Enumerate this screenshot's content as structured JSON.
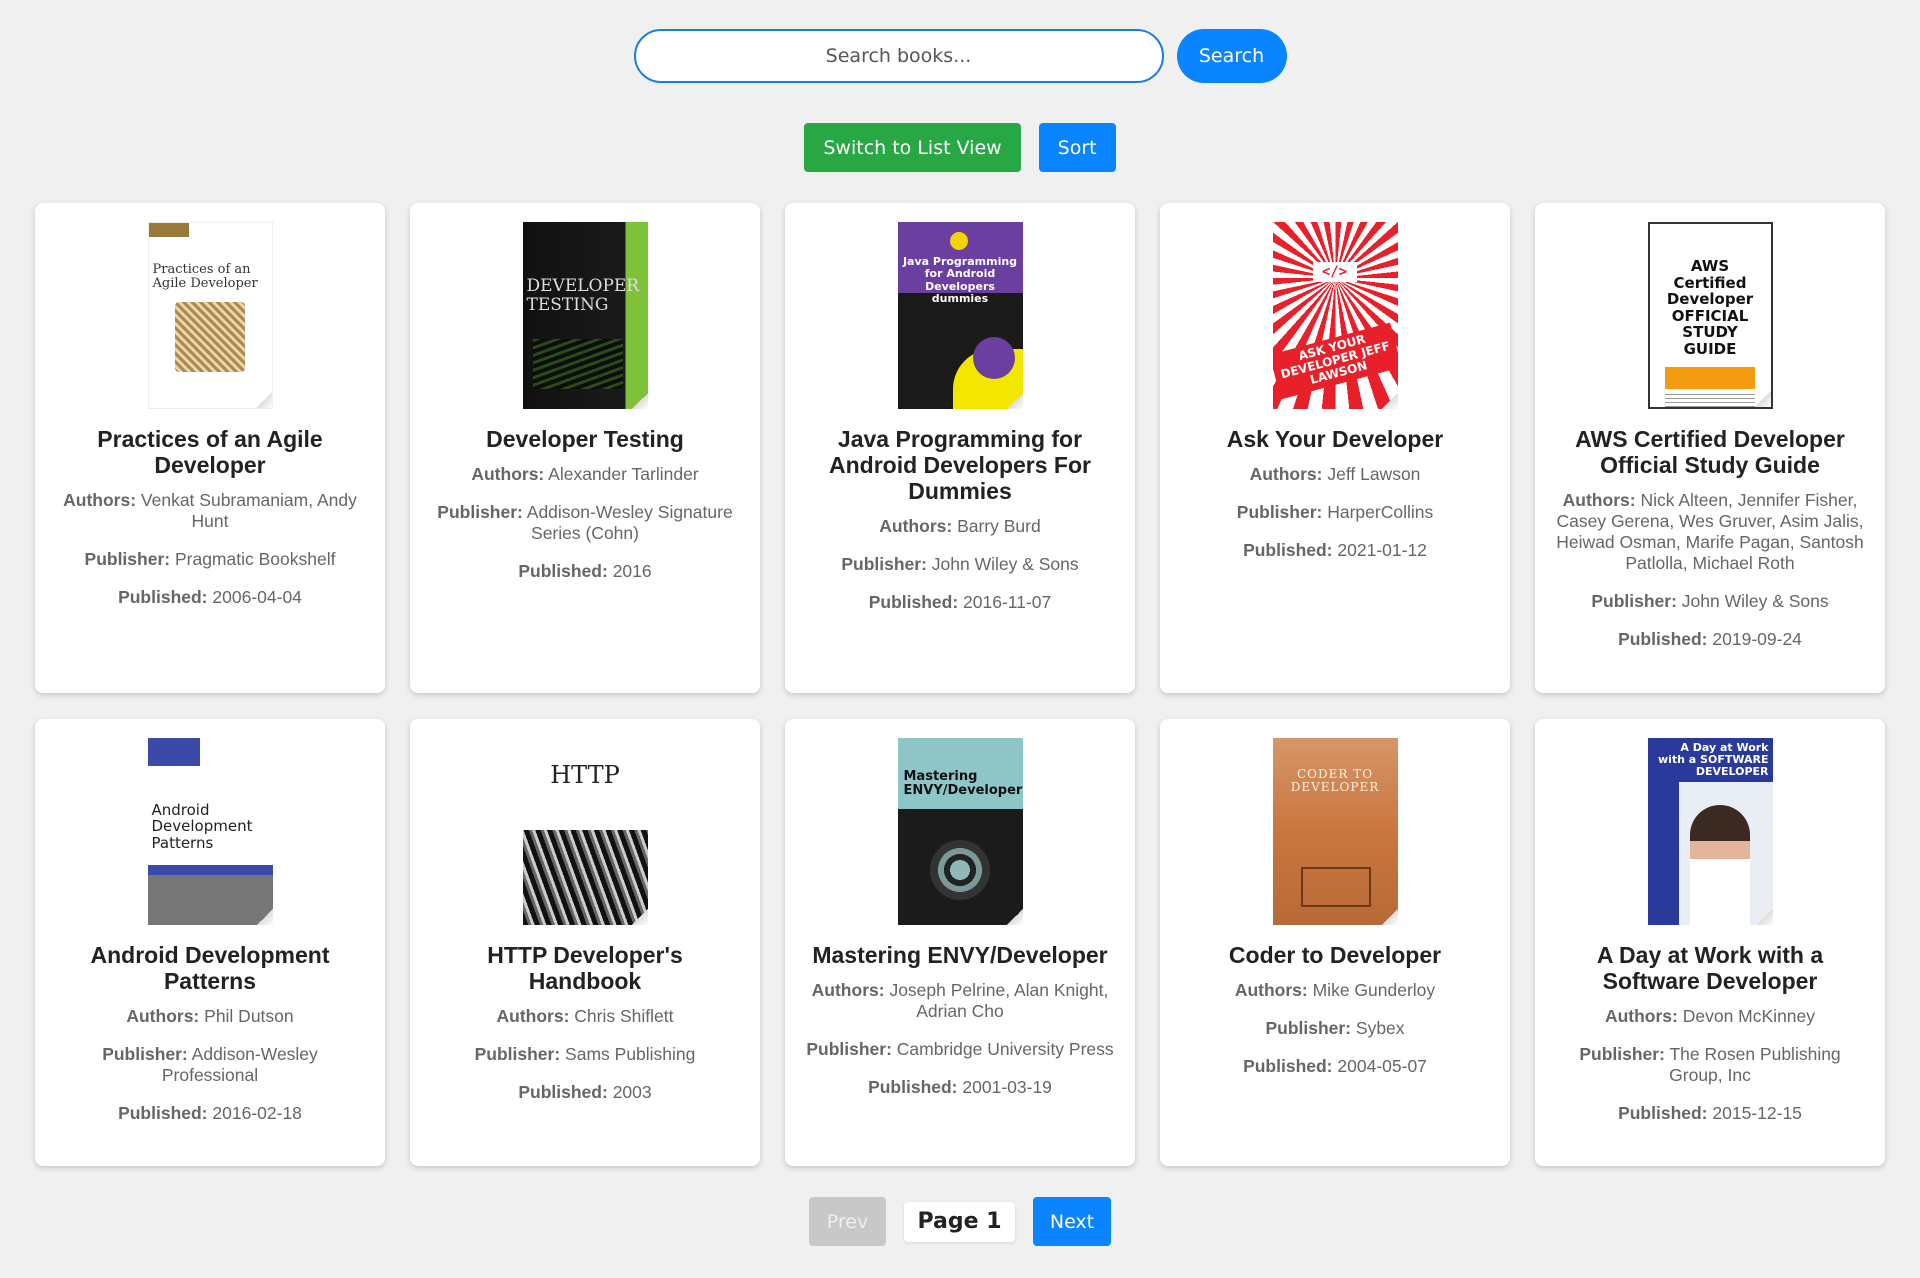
{
  "search": {
    "placeholder": "Search books...",
    "button_label": "Search"
  },
  "controls": {
    "view_label": "Switch to List View",
    "sort_label": "Sort"
  },
  "labels": {
    "authors": "Authors:",
    "publisher": "Publisher:",
    "published": "Published:"
  },
  "books": [
    {
      "title": "Practices of an Agile Developer",
      "authors": "Venkat Subramaniam, Andy Hunt",
      "publisher": "Pragmatic Bookshelf",
      "published": "2006-04-04",
      "cover_text": "Practices of an Agile Developer"
    },
    {
      "title": "Developer Testing",
      "authors": "Alexander Tarlinder",
      "publisher": "Addison-Wesley Signature Series (Cohn)",
      "published": "2016",
      "cover_text": "DEVELOPER TESTING"
    },
    {
      "title": "Java Programming for Android Developers For Dummies",
      "authors": "Barry Burd",
      "publisher": "John Wiley & Sons",
      "published": "2016-11-07",
      "cover_text": "Java Programming for Android Developers dummies"
    },
    {
      "title": "Ask Your Developer",
      "authors": "Jeff Lawson",
      "publisher": "HarperCollins",
      "published": "2021-01-12",
      "cover_text": "ASK YOUR DEVELOPER JEFF LAWSON"
    },
    {
      "title": "AWS Certified Developer Official Study Guide",
      "authors": "Nick Alteen, Jennifer Fisher, Casey Gerena, Wes Gruver, Asim Jalis, Heiwad Osman, Marife Pagan, Santosh Patlolla, Michael Roth",
      "publisher": "John Wiley & Sons",
      "published": "2019-09-24",
      "cover_text": "AWS Certified Developer OFFICIAL STUDY GUIDE"
    },
    {
      "title": "Android Development Patterns",
      "authors": "Phil Dutson",
      "publisher": "Addison-Wesley Professional",
      "published": "2016-02-18",
      "cover_text": "Android Development Patterns"
    },
    {
      "title": "HTTP Developer's Handbook",
      "authors": "Chris Shiflett",
      "publisher": "Sams Publishing",
      "published": "2003",
      "cover_text": "HTTP"
    },
    {
      "title": "Mastering ENVY/Developer",
      "authors": "Joseph Pelrine, Alan Knight, Adrian Cho",
      "publisher": "Cambridge University Press",
      "published": "2001-03-19",
      "cover_text": "Mastering ENVY/Developer"
    },
    {
      "title": "Coder to Developer",
      "authors": "Mike Gunderloy",
      "publisher": "Sybex",
      "published": "2004-05-07",
      "cover_text": "CODER TO DEVELOPER"
    },
    {
      "title": "A Day at Work with a Software Developer",
      "authors": "Devon McKinney",
      "publisher": "The Rosen Publishing Group, Inc",
      "published": "2015-12-15",
      "cover_text": "A Day at Work with a SOFTWARE DEVELOPER"
    }
  ],
  "pager": {
    "prev_label": "Prev",
    "page_label": "Page 1",
    "next_label": "Next"
  },
  "colors": {
    "primary": "#0a84ff",
    "success": "#28a745",
    "disabled": "#c8c8c8",
    "background": "#f0f0f0"
  }
}
